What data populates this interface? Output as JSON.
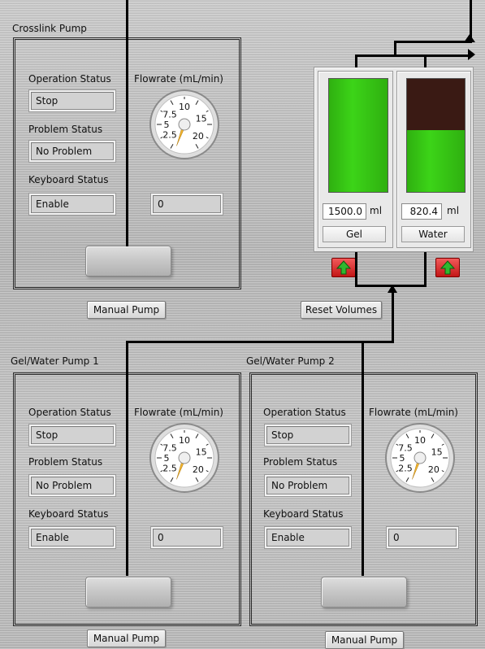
{
  "crosslink": {
    "title": "Crosslink Pump",
    "operation_label": "Operation Status",
    "operation_value": "Stop",
    "problem_label": "Problem Status",
    "problem_value": "No Problem",
    "keyboard_label": "Keyboard Status",
    "keyboard_value": "Enable",
    "flow_label": "Flowrate (mL/min)",
    "flow_value": "0",
    "manual_label": "Manual Pump"
  },
  "pump1": {
    "title": "Gel/Water Pump 1",
    "operation_label": "Operation Status",
    "operation_value": "Stop",
    "problem_label": "Problem Status",
    "problem_value": "No Problem",
    "keyboard_label": "Keyboard Status",
    "keyboard_value": "Enable",
    "flow_label": "Flowrate (mL/min)",
    "flow_value": "0",
    "manual_label": "Manual Pump"
  },
  "pump2": {
    "title": "Gel/Water Pump 2",
    "operation_label": "Operation Status",
    "operation_value": "Stop",
    "problem_label": "Problem Status",
    "problem_value": "No Problem",
    "keyboard_label": "Keyboard Status",
    "keyboard_value": "Enable",
    "flow_label": "Flowrate (mL/min)",
    "flow_value": "0",
    "manual_label": "Manual Pump"
  },
  "gauge": {
    "tick_labels": [
      "2.5",
      "5",
      "7.5",
      "10",
      "15",
      "20"
    ],
    "needle_color": "#f0b430"
  },
  "tanks": {
    "gel": {
      "volume": "1500.0",
      "unit": "ml",
      "name": "Gel",
      "fill_fraction": 1.0
    },
    "water": {
      "volume": "820.4",
      "unit": "ml",
      "name": "Water",
      "fill_fraction": 0.55
    },
    "fill_color": "#3cd418",
    "empty_color": "#3a1a14"
  },
  "reset_label": "Reset Volumes",
  "colors": {
    "refill_button": "#d41e1e",
    "refill_arrow": "#2fb82f"
  }
}
